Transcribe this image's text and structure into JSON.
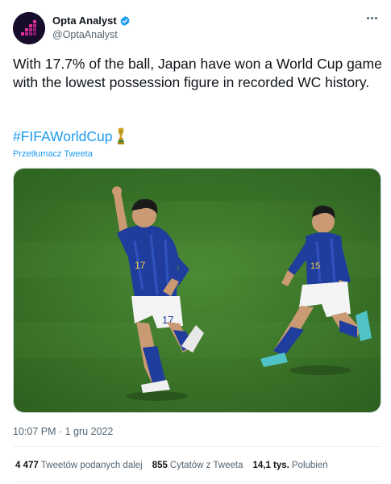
{
  "author": {
    "name": "Opta Analyst",
    "handle": "@OptaAnalyst",
    "verified": true,
    "avatar_color": "#170c2a",
    "avatar_accent": "#e0309a"
  },
  "tweet": {
    "text": "With 17.7% of the ball, Japan have won a World Cup game with the lowest possession figure in recorded WC history.",
    "hashtag": "#FIFAWorldCup",
    "hashtag_icon": "world-cup-trophy-icon",
    "translate_label": "Przetłumacz Tweeta",
    "media": {
      "description_icon": "photo",
      "players": [
        {
          "number": "17"
        },
        {
          "number": "15"
        }
      ]
    },
    "timestamp": "10:07 PM · 1 gru 2022"
  },
  "stats": {
    "retweets_count": "4 477",
    "retweets_label": "Tweetów podanych dalej",
    "quotes_count": "855",
    "quotes_label": "Cytatów z Tweeta",
    "likes_count": "14,1 tys.",
    "likes_label": "Polubień"
  },
  "colors": {
    "link": "#1d9bf0",
    "secondary_text": "#536471",
    "pitch": "#3f7a2c",
    "kit_blue": "#1f3d9c"
  }
}
